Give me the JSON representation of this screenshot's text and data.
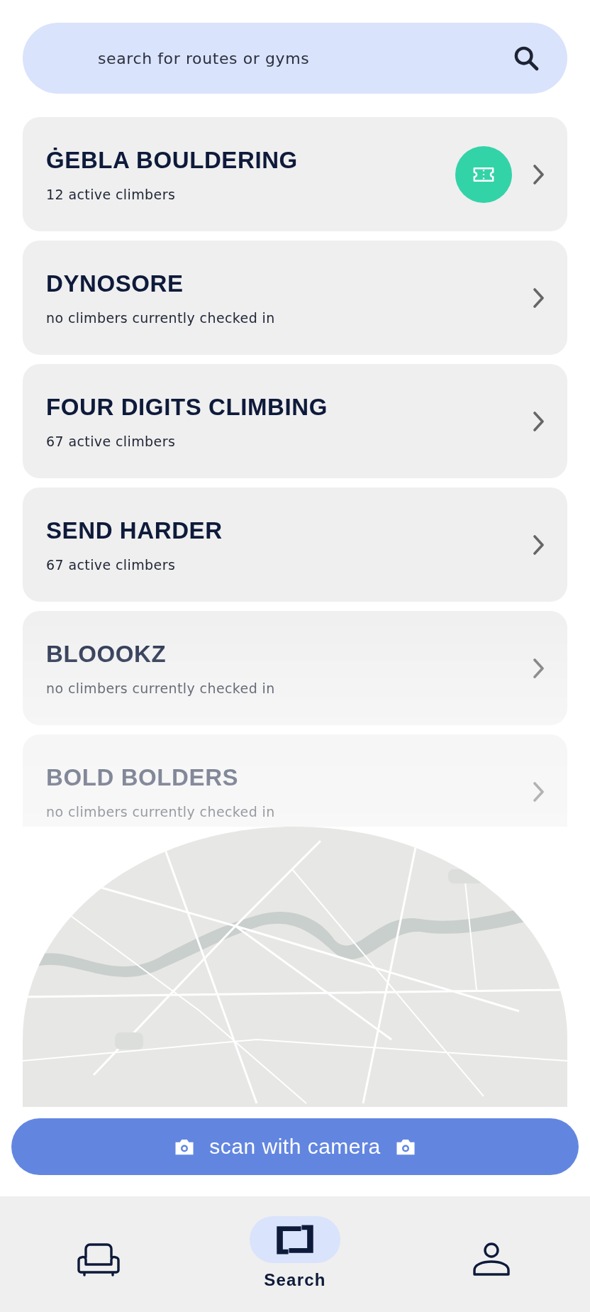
{
  "search": {
    "placeholder": "search for routes or gyms"
  },
  "gyms": [
    {
      "name": "ĠEBLA BOULDERING",
      "status": "12 active climbers",
      "ticket": true
    },
    {
      "name": "DYNOSORE",
      "status": "no climbers currently checked in",
      "ticket": false
    },
    {
      "name": "FOUR DIGITS CLIMBING",
      "status": "67 active climbers",
      "ticket": false
    },
    {
      "name": "SEND HARDER",
      "status": "67 active climbers",
      "ticket": false
    },
    {
      "name": "BLOOOKZ",
      "status": "no climbers currently checked in",
      "ticket": false
    },
    {
      "name": "BOLD BOLDERS",
      "status": "no climbers currently checked in",
      "ticket": false
    }
  ],
  "scan_button": {
    "label": "scan with camera"
  },
  "nav": [
    {
      "kind": "sofa",
      "selected": false
    },
    {
      "kind": "search",
      "label": "Search",
      "selected": true
    },
    {
      "kind": "profile",
      "selected": false
    }
  ]
}
